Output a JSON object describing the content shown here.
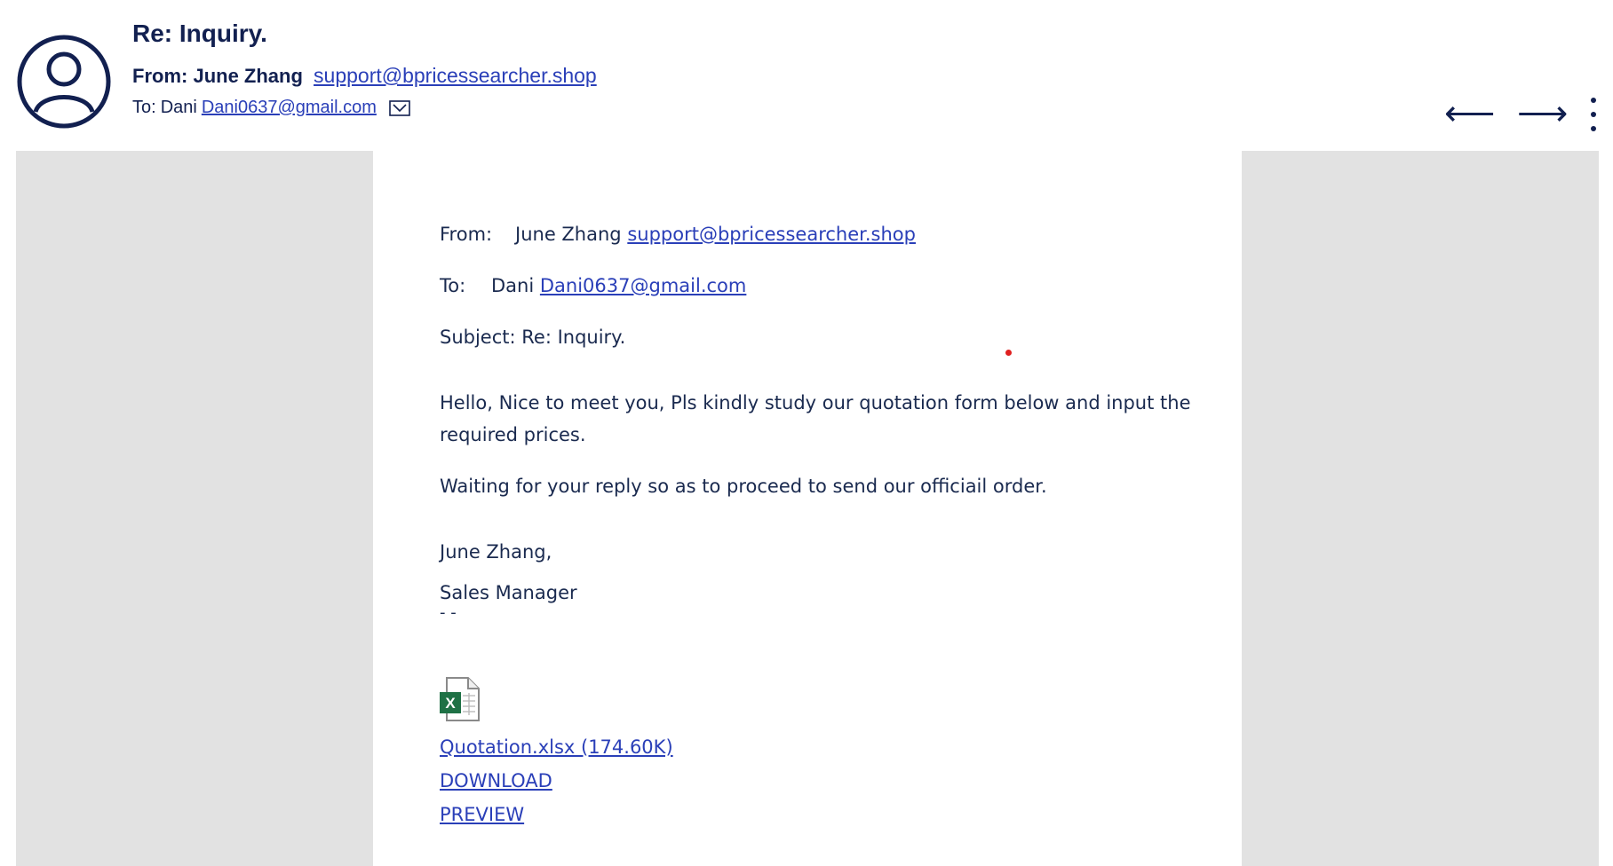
{
  "header": {
    "subject": "Re: Inquiry.",
    "from_prefix": "From:",
    "from_name": "June Zhang",
    "from_email": "support@bpricessearcher.shop",
    "to_prefix": "To:",
    "to_name": "Dani",
    "to_email": "Dani0637@gmail.com",
    "icons": {
      "avatar": "user-avatar-icon",
      "expand": "chevron-down-icon",
      "back": "arrow-left-icon",
      "forward": "arrow-right-icon",
      "more": "more-vertical-icon"
    }
  },
  "nav": {
    "back": "⟵",
    "forward": "⟶"
  },
  "body": {
    "from_label": "From:",
    "from_name": "June Zhang",
    "from_email": "support@bpricessearcher.shop",
    "to_label": "To:",
    "to_name": "Dani",
    "to_email": "Dani0637@gmail.com",
    "subject_line": "Subject: Re: Inquiry.",
    "paragraph_1a": "Hello, Nice to meet you, Pls kindly study our quotation form below and input the",
    "paragraph_1b": "required prices.",
    "paragraph_2": "Waiting for your reply so as to proceed to send our officiail order.",
    "signature_name": "June Zhang,",
    "signature_title": "Sales Manager",
    "separator": "- -",
    "attachment": {
      "icon": "excel-file-icon",
      "filename": "Quotation.xlsx (174.60K)",
      "download_label": "DOWNLOAD",
      "preview_label": "PREVIEW"
    }
  },
  "colors": {
    "text": "#122050",
    "link": "#2a3fb8",
    "gutter": "#e2e2e2",
    "excel_green": "#1e7145"
  }
}
